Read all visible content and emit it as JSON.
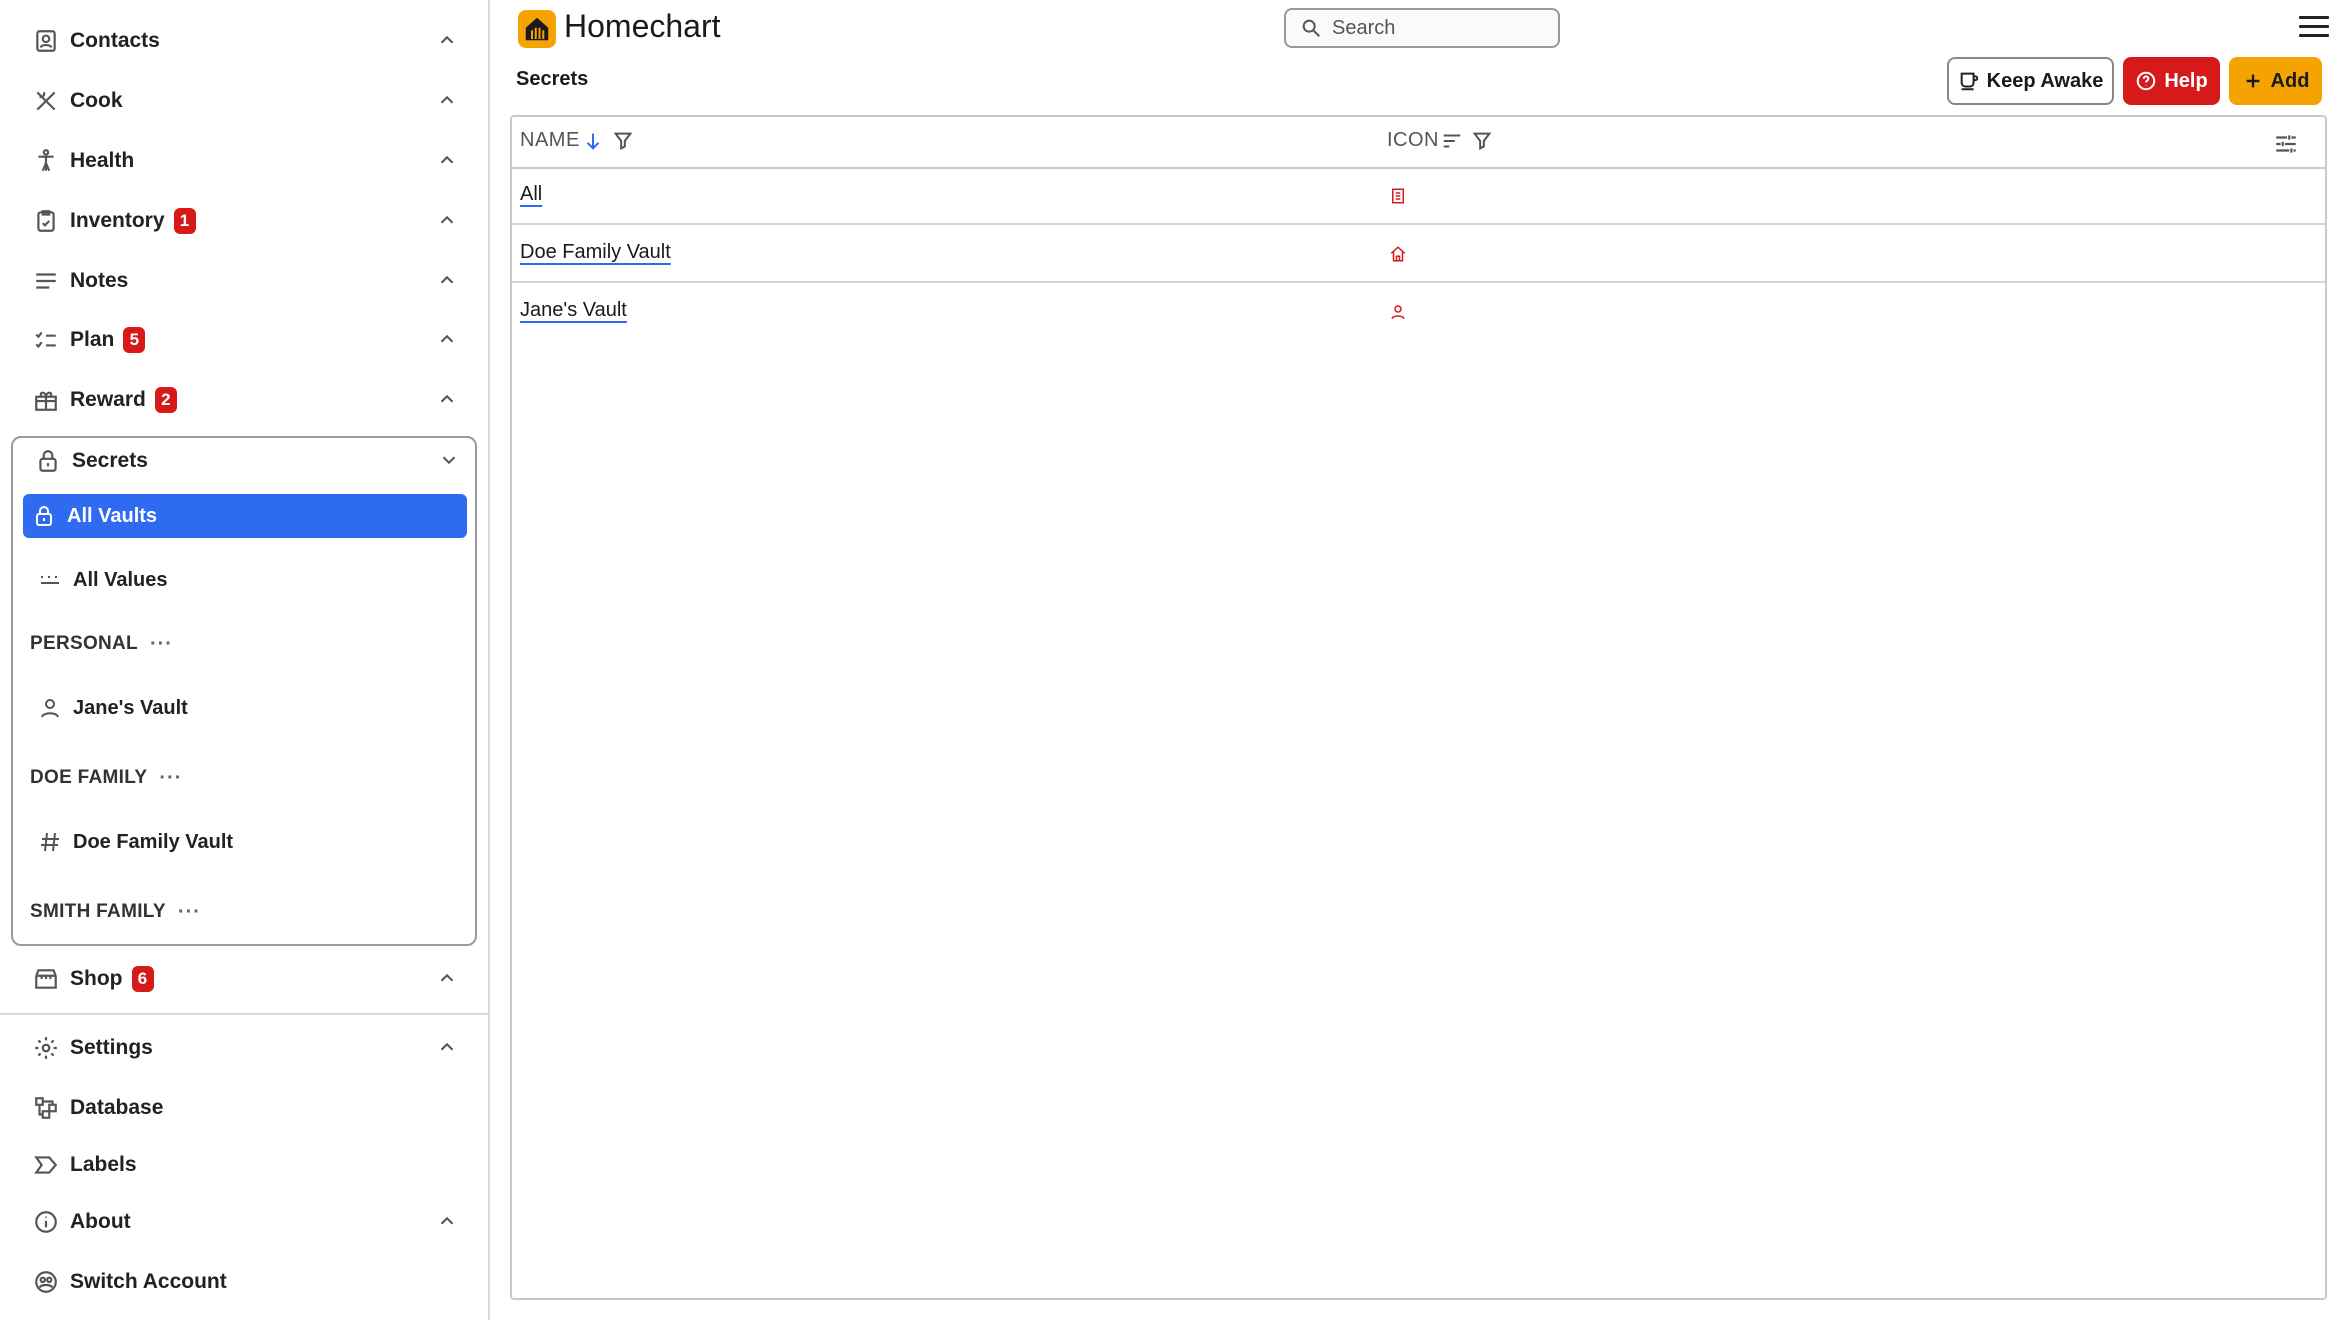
{
  "app": {
    "title": "Homechart"
  },
  "search": {
    "placeholder": "Search"
  },
  "page": {
    "title": "Secrets"
  },
  "toolbar": {
    "keep_awake": "Keep Awake",
    "help": "Help",
    "add": "Add"
  },
  "sidebar": {
    "items": [
      {
        "label": "Contacts",
        "icon": "contacts-icon"
      },
      {
        "label": "Cook",
        "icon": "utensils-icon"
      },
      {
        "label": "Health",
        "icon": "person-icon"
      },
      {
        "label": "Inventory",
        "icon": "clipboard-icon",
        "badge": "1"
      },
      {
        "label": "Notes",
        "icon": "lines-icon"
      },
      {
        "label": "Plan",
        "icon": "checklist-icon",
        "badge": "5"
      },
      {
        "label": "Reward",
        "icon": "gift-icon",
        "badge": "2"
      },
      {
        "label": "Secrets",
        "icon": "lock-icon"
      },
      {
        "label": "Shop",
        "icon": "store-icon",
        "badge": "6"
      },
      {
        "label": "Settings",
        "icon": "gear-icon"
      },
      {
        "label": "Database",
        "icon": "database-icon"
      },
      {
        "label": "Labels",
        "icon": "label-icon"
      },
      {
        "label": "About",
        "icon": "info-icon"
      },
      {
        "label": "Switch Account",
        "icon": "switch-account-icon"
      }
    ],
    "secrets": {
      "all_vaults": "All Vaults",
      "all_values": "All Values",
      "groups": [
        {
          "header": "PERSONAL",
          "vault": "Jane's Vault"
        },
        {
          "header": "DOE FAMILY",
          "vault": "Doe Family Vault"
        },
        {
          "header": "SMITH FAMILY"
        }
      ],
      "dots": "···"
    }
  },
  "table": {
    "columns": [
      "NAME",
      "ICON"
    ],
    "rows": [
      {
        "name": "All",
        "icon": "all-icon"
      },
      {
        "name": "Doe Family Vault",
        "icon": "house-icon"
      },
      {
        "name": "Jane's Vault",
        "icon": "user-icon"
      }
    ]
  },
  "colors": {
    "accent": "#2f6bf0",
    "danger": "#d61a1a",
    "brand": "#f5a300"
  }
}
